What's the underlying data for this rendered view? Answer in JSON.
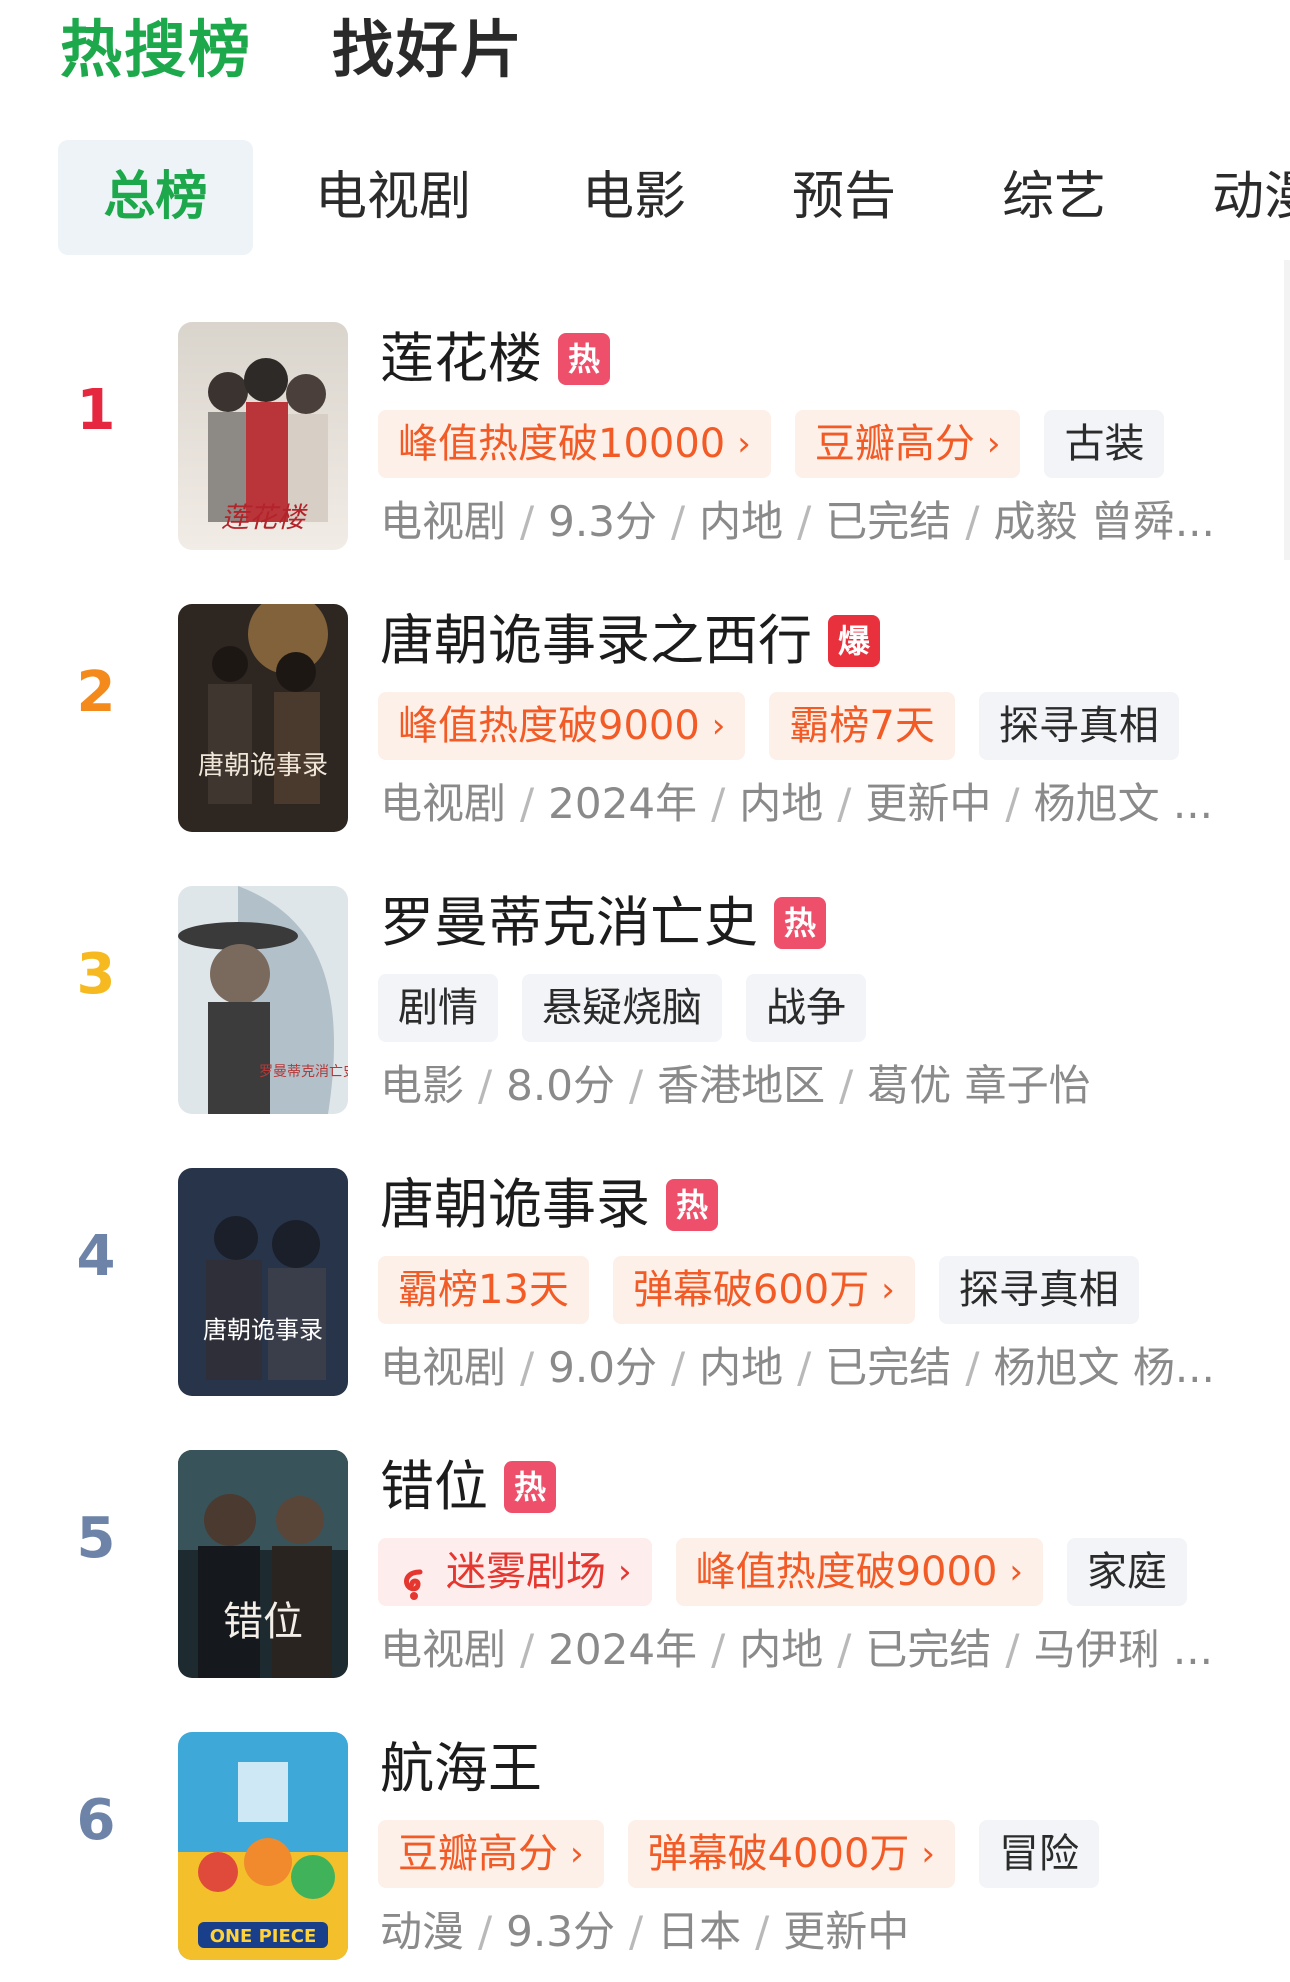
{
  "top_tabs": [
    "热搜榜",
    "找好片"
  ],
  "category_tabs": [
    "总榜",
    "电视剧",
    "电影",
    "预告",
    "综艺",
    "动漫"
  ],
  "colors": {
    "brand_green": "#1ea84c",
    "rank_1": "#e5273f",
    "rank_2": "#f48a1b",
    "rank_3": "#f6b91f",
    "rank_other": "#6d84a8"
  },
  "items": [
    {
      "rank": "1",
      "title": "莲花楼",
      "badge": "热",
      "badge_kind": "hot",
      "tags": [
        {
          "text": "峰值热度破10000",
          "style": "orange",
          "chevron": true
        },
        {
          "text": "豆瓣高分",
          "style": "orange",
          "chevron": true
        },
        {
          "text": "古装",
          "style": "gray",
          "chevron": false
        }
      ],
      "meta": [
        "电视剧",
        "9.3分",
        "内地",
        "已完结",
        "成毅 曾舜..."
      ]
    },
    {
      "rank": "2",
      "title": "唐朝诡事录之西行",
      "badge": "爆",
      "badge_kind": "boom",
      "tags": [
        {
          "text": "峰值热度破9000",
          "style": "orange",
          "chevron": true
        },
        {
          "text": "霸榜7天",
          "style": "orange",
          "chevron": false
        },
        {
          "text": "探寻真相",
          "style": "gray",
          "chevron": false
        }
      ],
      "meta": [
        "电视剧",
        "2024年",
        "内地",
        "更新中",
        "杨旭文 ..."
      ]
    },
    {
      "rank": "3",
      "title": "罗曼蒂克消亡史",
      "badge": "热",
      "badge_kind": "hot",
      "tags": [
        {
          "text": "剧情",
          "style": "gray",
          "chevron": false
        },
        {
          "text": "悬疑烧脑",
          "style": "gray",
          "chevron": false
        },
        {
          "text": "战争",
          "style": "gray",
          "chevron": false
        }
      ],
      "meta": [
        "电影",
        "8.0分",
        "香港地区",
        "葛优 章子怡"
      ]
    },
    {
      "rank": "4",
      "title": "唐朝诡事录",
      "badge": "热",
      "badge_kind": "hot",
      "tags": [
        {
          "text": "霸榜13天",
          "style": "orange",
          "chevron": false
        },
        {
          "text": "弹幕破600万",
          "style": "orange",
          "chevron": true
        },
        {
          "text": "探寻真相",
          "style": "gray",
          "chevron": false
        }
      ],
      "meta": [
        "电视剧",
        "9.0分",
        "内地",
        "已完结",
        "杨旭文 杨..."
      ]
    },
    {
      "rank": "5",
      "title": "错位",
      "badge": "热",
      "badge_kind": "hot",
      "tags": [
        {
          "text": "迷雾剧场",
          "style": "red",
          "chevron": true,
          "icon": true
        },
        {
          "text": "峰值热度破9000",
          "style": "orange",
          "chevron": true
        },
        {
          "text": "家庭",
          "style": "gray",
          "chevron": false
        }
      ],
      "meta": [
        "电视剧",
        "2024年",
        "内地",
        "已完结",
        "马伊琍 ..."
      ]
    },
    {
      "rank": "6",
      "title": "航海王",
      "badge": "",
      "badge_kind": "",
      "tags": [
        {
          "text": "豆瓣高分",
          "style": "orange",
          "chevron": true
        },
        {
          "text": "弹幕破4000万",
          "style": "orange",
          "chevron": true
        },
        {
          "text": "冒险",
          "style": "gray",
          "chevron": false
        }
      ],
      "meta": [
        "动漫",
        "9.3分",
        "日本",
        "更新中"
      ]
    }
  ]
}
